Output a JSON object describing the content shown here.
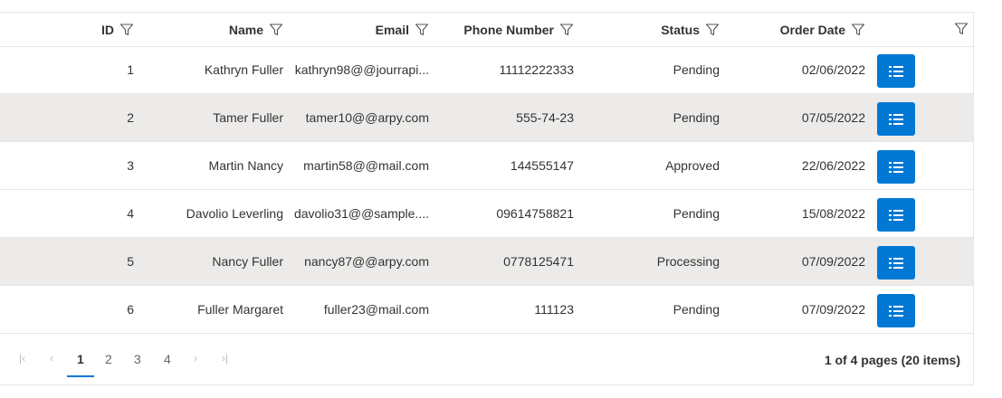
{
  "columns": {
    "id": "ID",
    "name": "Name",
    "email": "Email",
    "phone": "Phone Number",
    "status": "Status",
    "order_date": "Order Date"
  },
  "rows": [
    {
      "id": "1",
      "name": "Kathryn Fuller",
      "email": "kathryn98@@jourrapi...",
      "phone": "11112222333",
      "status": "Pending",
      "order_date": "02/06/2022"
    },
    {
      "id": "2",
      "name": "Tamer Fuller",
      "email": "tamer10@@arpy.com",
      "phone": "555-74-23",
      "status": "Pending",
      "order_date": "07/05/2022"
    },
    {
      "id": "3",
      "name": "Martin Nancy",
      "email": "martin58@@mail.com",
      "phone": "144555147",
      "status": "Approved",
      "order_date": "22/06/2022"
    },
    {
      "id": "4",
      "name": "Davolio Leverling",
      "email": "davolio31@@sample....",
      "phone": "09614758821",
      "status": "Pending",
      "order_date": "15/08/2022"
    },
    {
      "id": "5",
      "name": "Nancy Fuller",
      "email": "nancy87@@arpy.com",
      "phone": "0778125471",
      "status": "Processing",
      "order_date": "07/09/2022"
    },
    {
      "id": "6",
      "name": "Fuller Margaret",
      "email": "fuller23@mail.com",
      "phone": "111123",
      "status": "Pending",
      "order_date": "07/09/2022"
    }
  ],
  "row_action_icon": "list-icon",
  "pager": {
    "first_icon": "first-page-icon",
    "prev_icon": "previous-page-icon",
    "next_icon": "next-page-icon",
    "last_icon": "last-page-icon",
    "first_glyph": "|‹",
    "prev_glyph": "‹",
    "next_glyph": "›",
    "last_glyph": "›|",
    "pages": [
      "1",
      "2",
      "3",
      "4"
    ],
    "current_page": "1",
    "info": "1 of 4 pages (20 items)"
  },
  "colors": {
    "accent": "#0078d4",
    "alt_row": "#edebe9",
    "border": "#e6e6e6"
  }
}
